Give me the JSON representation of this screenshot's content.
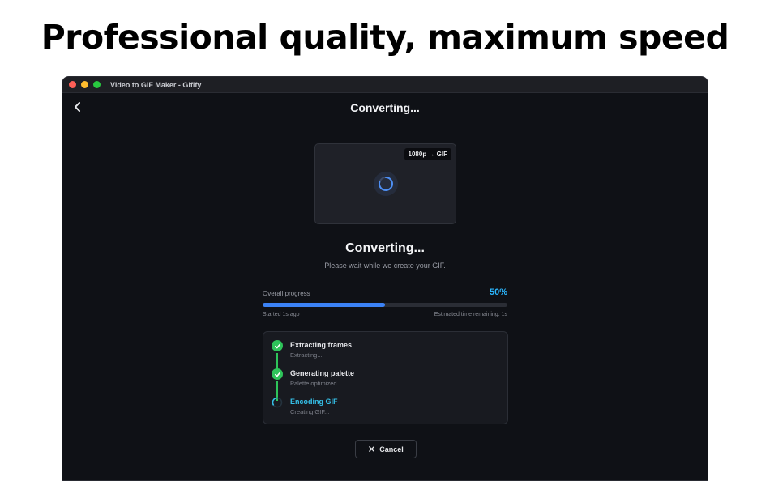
{
  "headline": "Professional quality, maximum speed",
  "window": {
    "title": "Video to GIF Maker - Gifify"
  },
  "header": {
    "title": "Converting...",
    "back_icon": "chevron-left-icon"
  },
  "preview": {
    "badge": "1080p → GIF",
    "spinner_icon": "loading-spinner-icon"
  },
  "status": {
    "title": "Converting...",
    "subtitle": "Please wait while we create your GIF."
  },
  "progress": {
    "label": "Overall progress",
    "percent_text": "50%",
    "fraction": 0.5,
    "started": "Started 1s ago",
    "eta": "Estimated time remaining: 1s"
  },
  "steps": [
    {
      "title": "Extracting frames",
      "subtitle": "Extracting...",
      "state": "done",
      "icon": "check-icon"
    },
    {
      "title": "Generating palette",
      "subtitle": "Palette optimized",
      "state": "done",
      "icon": "check-icon"
    },
    {
      "title": "Encoding GIF",
      "subtitle": "Creating GIF...",
      "state": "active",
      "icon": "loading-spinner-icon"
    }
  ],
  "cancel_button": {
    "label": "Cancel",
    "icon": "close-icon"
  },
  "colors": {
    "accent": "#3b82f6",
    "accent_text": "#2bb7ff",
    "success": "#2ec45a",
    "active_step": "#35c0e8",
    "background": "#0f1116"
  }
}
